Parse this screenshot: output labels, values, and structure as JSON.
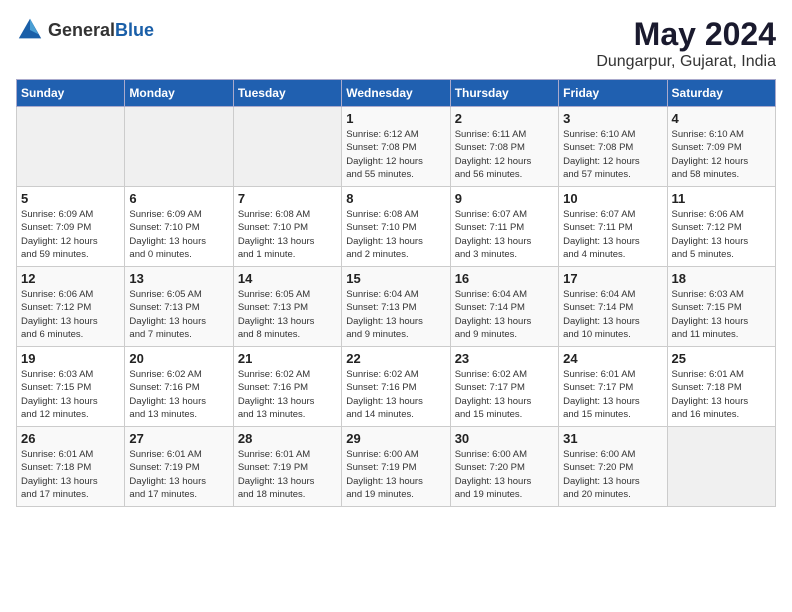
{
  "header": {
    "logo_general": "General",
    "logo_blue": "Blue",
    "title": "May 2024",
    "subtitle": "Dungarpur, Gujarat, India"
  },
  "weekdays": [
    "Sunday",
    "Monday",
    "Tuesday",
    "Wednesday",
    "Thursday",
    "Friday",
    "Saturday"
  ],
  "weeks": [
    [
      {
        "day": "",
        "info": ""
      },
      {
        "day": "",
        "info": ""
      },
      {
        "day": "",
        "info": ""
      },
      {
        "day": "1",
        "info": "Sunrise: 6:12 AM\nSunset: 7:08 PM\nDaylight: 12 hours\nand 55 minutes."
      },
      {
        "day": "2",
        "info": "Sunrise: 6:11 AM\nSunset: 7:08 PM\nDaylight: 12 hours\nand 56 minutes."
      },
      {
        "day": "3",
        "info": "Sunrise: 6:10 AM\nSunset: 7:08 PM\nDaylight: 12 hours\nand 57 minutes."
      },
      {
        "day": "4",
        "info": "Sunrise: 6:10 AM\nSunset: 7:09 PM\nDaylight: 12 hours\nand 58 minutes."
      }
    ],
    [
      {
        "day": "5",
        "info": "Sunrise: 6:09 AM\nSunset: 7:09 PM\nDaylight: 12 hours\nand 59 minutes."
      },
      {
        "day": "6",
        "info": "Sunrise: 6:09 AM\nSunset: 7:10 PM\nDaylight: 13 hours\nand 0 minutes."
      },
      {
        "day": "7",
        "info": "Sunrise: 6:08 AM\nSunset: 7:10 PM\nDaylight: 13 hours\nand 1 minute."
      },
      {
        "day": "8",
        "info": "Sunrise: 6:08 AM\nSunset: 7:10 PM\nDaylight: 13 hours\nand 2 minutes."
      },
      {
        "day": "9",
        "info": "Sunrise: 6:07 AM\nSunset: 7:11 PM\nDaylight: 13 hours\nand 3 minutes."
      },
      {
        "day": "10",
        "info": "Sunrise: 6:07 AM\nSunset: 7:11 PM\nDaylight: 13 hours\nand 4 minutes."
      },
      {
        "day": "11",
        "info": "Sunrise: 6:06 AM\nSunset: 7:12 PM\nDaylight: 13 hours\nand 5 minutes."
      }
    ],
    [
      {
        "day": "12",
        "info": "Sunrise: 6:06 AM\nSunset: 7:12 PM\nDaylight: 13 hours\nand 6 minutes."
      },
      {
        "day": "13",
        "info": "Sunrise: 6:05 AM\nSunset: 7:13 PM\nDaylight: 13 hours\nand 7 minutes."
      },
      {
        "day": "14",
        "info": "Sunrise: 6:05 AM\nSunset: 7:13 PM\nDaylight: 13 hours\nand 8 minutes."
      },
      {
        "day": "15",
        "info": "Sunrise: 6:04 AM\nSunset: 7:13 PM\nDaylight: 13 hours\nand 9 minutes."
      },
      {
        "day": "16",
        "info": "Sunrise: 6:04 AM\nSunset: 7:14 PM\nDaylight: 13 hours\nand 9 minutes."
      },
      {
        "day": "17",
        "info": "Sunrise: 6:04 AM\nSunset: 7:14 PM\nDaylight: 13 hours\nand 10 minutes."
      },
      {
        "day": "18",
        "info": "Sunrise: 6:03 AM\nSunset: 7:15 PM\nDaylight: 13 hours\nand 11 minutes."
      }
    ],
    [
      {
        "day": "19",
        "info": "Sunrise: 6:03 AM\nSunset: 7:15 PM\nDaylight: 13 hours\nand 12 minutes."
      },
      {
        "day": "20",
        "info": "Sunrise: 6:02 AM\nSunset: 7:16 PM\nDaylight: 13 hours\nand 13 minutes."
      },
      {
        "day": "21",
        "info": "Sunrise: 6:02 AM\nSunset: 7:16 PM\nDaylight: 13 hours\nand 13 minutes."
      },
      {
        "day": "22",
        "info": "Sunrise: 6:02 AM\nSunset: 7:16 PM\nDaylight: 13 hours\nand 14 minutes."
      },
      {
        "day": "23",
        "info": "Sunrise: 6:02 AM\nSunset: 7:17 PM\nDaylight: 13 hours\nand 15 minutes."
      },
      {
        "day": "24",
        "info": "Sunrise: 6:01 AM\nSunset: 7:17 PM\nDaylight: 13 hours\nand 15 minutes."
      },
      {
        "day": "25",
        "info": "Sunrise: 6:01 AM\nSunset: 7:18 PM\nDaylight: 13 hours\nand 16 minutes."
      }
    ],
    [
      {
        "day": "26",
        "info": "Sunrise: 6:01 AM\nSunset: 7:18 PM\nDaylight: 13 hours\nand 17 minutes."
      },
      {
        "day": "27",
        "info": "Sunrise: 6:01 AM\nSunset: 7:19 PM\nDaylight: 13 hours\nand 17 minutes."
      },
      {
        "day": "28",
        "info": "Sunrise: 6:01 AM\nSunset: 7:19 PM\nDaylight: 13 hours\nand 18 minutes."
      },
      {
        "day": "29",
        "info": "Sunrise: 6:00 AM\nSunset: 7:19 PM\nDaylight: 13 hours\nand 19 minutes."
      },
      {
        "day": "30",
        "info": "Sunrise: 6:00 AM\nSunset: 7:20 PM\nDaylight: 13 hours\nand 19 minutes."
      },
      {
        "day": "31",
        "info": "Sunrise: 6:00 AM\nSunset: 7:20 PM\nDaylight: 13 hours\nand 20 minutes."
      },
      {
        "day": "",
        "info": ""
      }
    ]
  ]
}
